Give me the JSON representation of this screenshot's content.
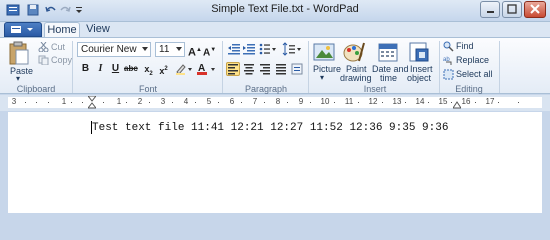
{
  "window": {
    "title": "Simple Text File.txt - WordPad"
  },
  "tabs": [
    {
      "label": "Home"
    },
    {
      "label": "View"
    }
  ],
  "clipboard": {
    "paste": "Paste",
    "cut": "Cut",
    "copy": "Copy",
    "group": "Clipboard"
  },
  "font": {
    "family": "Courier New",
    "size": "11",
    "group": "Font"
  },
  "paragraph": {
    "group": "Paragraph"
  },
  "insert": {
    "picture": "Picture",
    "paint1": "Paint",
    "paint2": "drawing",
    "date1": "Date and",
    "date2": "time",
    "object1": "Insert",
    "object2": "object",
    "group": "Insert"
  },
  "editing": {
    "find": "Find",
    "replace": "Replace",
    "select_all": "Select all",
    "group": "Editing"
  },
  "ruler": {
    "labels": [
      "3",
      "1",
      "1",
      "2",
      "3",
      "4",
      "5",
      "6",
      "7",
      "8",
      "9",
      "10",
      "11",
      "12",
      "13",
      "14",
      "15",
      "16",
      "17"
    ]
  },
  "document": {
    "text": "Test text file 11:41 12:21 12:27 11:52 12:36 9:35 9:36"
  },
  "colors": {
    "accent": "#2a5ba5",
    "ribbon_bg": "#e4ecf6",
    "frame": "#c7d6ea",
    "highlight": "#ffe38a"
  }
}
